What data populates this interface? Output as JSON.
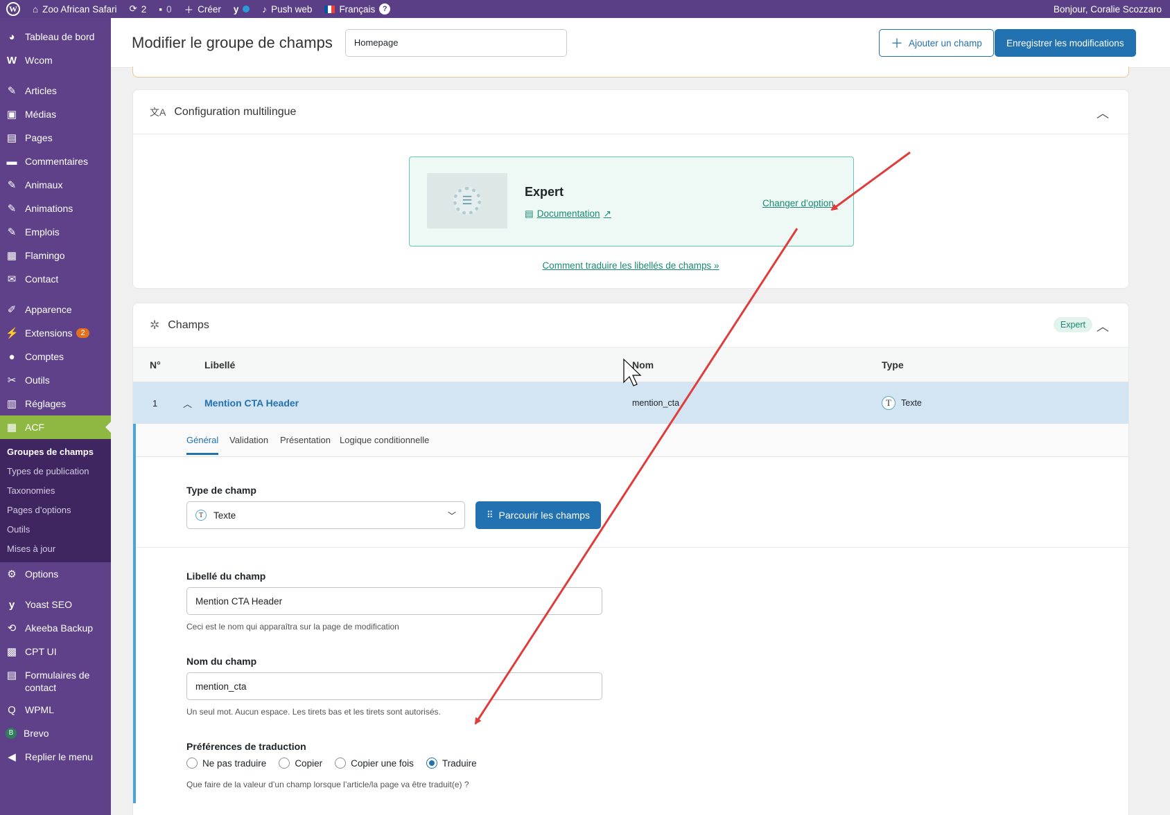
{
  "adminbar": {
    "site_name": "Zoo African Safari",
    "updates_count": "2",
    "comments_count": "0",
    "create_label": "Créer",
    "push_label": "Push web",
    "language_label": "Français",
    "greeting": "Bonjour, Coralie Scozzaro"
  },
  "sidebar": {
    "items": [
      {
        "label": "Tableau de bord",
        "icon": "dashboard-icon"
      },
      {
        "label": "Wcom",
        "icon": "wcom-icon"
      },
      {
        "label": "Articles",
        "icon": "pin-icon"
      },
      {
        "label": "Médias",
        "icon": "media-icon"
      },
      {
        "label": "Pages",
        "icon": "pages-icon"
      },
      {
        "label": "Commentaires",
        "icon": "comments-icon"
      },
      {
        "label": "Animaux",
        "icon": "pin-icon"
      },
      {
        "label": "Animations",
        "icon": "pin-icon"
      },
      {
        "label": "Emplois",
        "icon": "pin-icon"
      },
      {
        "label": "Flamingo",
        "icon": "flamingo-icon"
      },
      {
        "label": "Contact",
        "icon": "mail-icon"
      },
      {
        "label": "Apparence",
        "icon": "brush-icon"
      },
      {
        "label": "Extensions",
        "icon": "plugin-icon",
        "badge": "2"
      },
      {
        "label": "Comptes",
        "icon": "users-icon"
      },
      {
        "label": "Outils",
        "icon": "wrench-icon"
      },
      {
        "label": "Réglages",
        "icon": "settings-icon"
      },
      {
        "label": "ACF",
        "icon": "acf-icon"
      },
      {
        "label": "Options",
        "icon": "gear-icon"
      },
      {
        "label": "Yoast SEO",
        "icon": "yoast-icon"
      },
      {
        "label": "Akeeba Backup",
        "icon": "backup-icon"
      },
      {
        "label": "CPT UI",
        "icon": "cptui-icon"
      },
      {
        "label": "Formulaires de contact",
        "icon": "form-icon"
      },
      {
        "label": "WPML",
        "icon": "wpml-icon"
      },
      {
        "label": "Brevo",
        "icon": "brevo-icon"
      },
      {
        "label": "Replier le menu",
        "icon": "collapse-icon"
      }
    ],
    "acf_submenu": [
      "Groupes de champs",
      "Types de publication",
      "Taxonomies",
      "Pages d’options",
      "Outils",
      "Mises à jour"
    ]
  },
  "header": {
    "title": "Modifier le groupe de champs",
    "group_name": "Homepage",
    "add_field_label": "Ajouter un champ",
    "save_label": "Enregistrer les modifications"
  },
  "multilingual": {
    "title": "Configuration multilingue",
    "option_title": "Expert",
    "documentation_label": "Documentation",
    "change_option_label": "Changer d’option",
    "how_to_link": "Comment traduire les libellés de champs »"
  },
  "fields_panel": {
    "title": "Champs",
    "mode_badge": "Expert",
    "columns": [
      "N°",
      "Libellé",
      "Nom",
      "Type"
    ],
    "row": {
      "number": "1",
      "label": "Mention CTA Header",
      "name": "mention_cta",
      "type": "Texte"
    }
  },
  "field_settings": {
    "tabs": [
      "Général",
      "Validation",
      "Présentation",
      "Logique conditionnelle"
    ],
    "field_type_label": "Type de champ",
    "field_type_value": "Texte",
    "browse_label": "Parcourir les champs",
    "field_label_label": "Libellé du champ",
    "field_label_value": "Mention CTA Header",
    "field_label_help": "Ceci est le nom qui apparaîtra sur la page de modification",
    "field_name_label": "Nom du champ",
    "field_name_value": "mention_cta",
    "field_name_help": "Un seul mot. Aucun espace. Les tirets bas et les tirets sont autorisés.",
    "translation_label": "Préférences de traduction",
    "translation_options": [
      "Ne pas traduire",
      "Copier",
      "Copier une fois",
      "Traduire"
    ],
    "translation_selected": "Traduire",
    "translation_help": "Que faire de la valeur d’un champ lorsque l’article/la page va être traduit(e) ?"
  },
  "colors": {
    "admin_purple": "#5e4188",
    "acf_green": "#8fb843",
    "primary_blue": "#2271b1",
    "annotation_red": "#e03c3c",
    "teal": "#198a70"
  }
}
